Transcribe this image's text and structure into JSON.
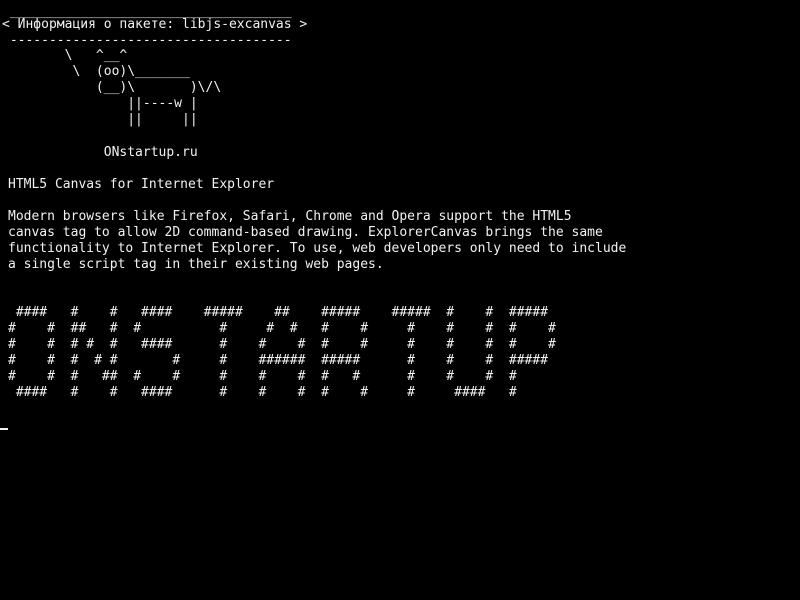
{
  "screen": {
    "foreground_color": "#f2f2f2",
    "background_color": "#000000",
    "header_border_top": " ____________________________________",
    "header_title": "< Информация о пакете: libjs-excanvas >",
    "header_border_bottom": " ------------------------------------",
    "cow": [
      "        \\   ^__^",
      "         \\  (oo)\\_______",
      "            (__)\\       )\\/\\",
      "                ||----w |",
      "                ||     ||"
    ],
    "site_label": "             ONstartup.ru",
    "package_title": "HTML5 Canvas for Internet Explorer",
    "description": [
      "Modern browsers like Firefox, Safari, Chrome and Opera support the HTML5",
      "canvas tag to allow 2D command-based drawing. ExplorerCanvas brings the same",
      "functionality to Internet Explorer. To use, web developers only need to include",
      "a single script tag in their existing web pages."
    ],
    "banner": [
      " ####   #    #   ####    #####    ##    #####    #####  #    #  #####",
      "#    #  ##   #  #          #     #  #   #    #     #    #    #  #    #",
      "#    #  # #  #   ####      #    #    #  #    #     #    #    #  #    #",
      "#    #  #  # #       #     #    ######  #####      #    #    #  #####",
      "#    #  #   ##  #    #     #    #    #  #   #      #    #    #  #",
      " ####   #    #   ####      #    #    #  #    #     #     ####   #"
    ]
  }
}
